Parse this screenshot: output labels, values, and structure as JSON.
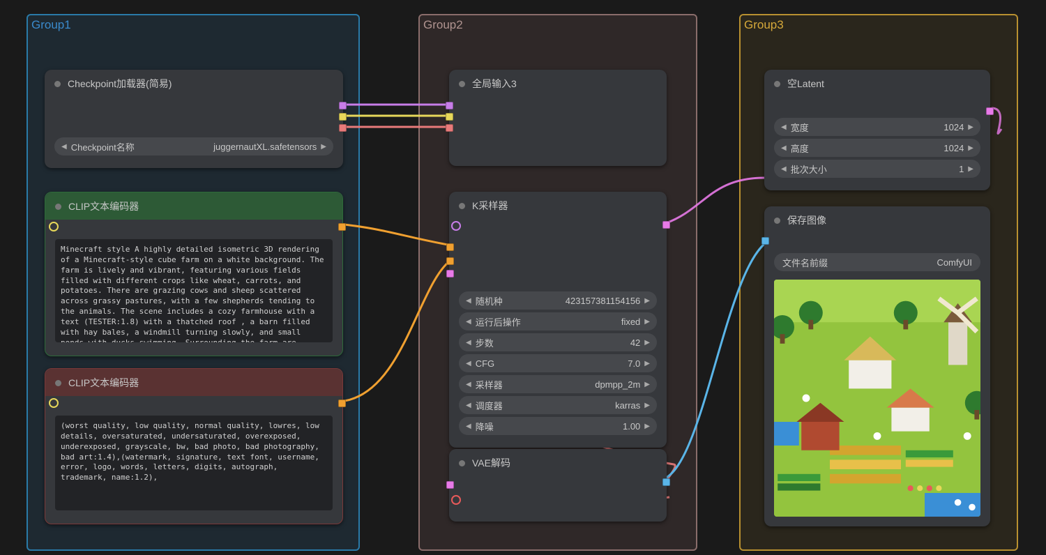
{
  "groups": {
    "g1": "Group1",
    "g2": "Group2",
    "g3": "Group3"
  },
  "checkpoint": {
    "title": "Checkpoint加载器(简易)",
    "param_label": "Checkpoint名称",
    "param_value": "juggernautXL.safetensors"
  },
  "clip_pos": {
    "title": "CLIP文本编码器",
    "text": "Minecraft style A highly detailed isometric 3D rendering of a Minecraft-style cube farm on a white background. The farm is lively and vibrant, featuring various fields filled with different crops like wheat, carrots, and potatoes. There are grazing cows and sheep scattered across grassy pastures, with a few shepherds tending to the animals. The scene includes a cozy farmhouse with a text (TESTER:1.8) with a thatched roof , a barn filled with hay bales, a windmill turning slowly, and small ponds with ducks swimming. Surrounding the farm are colorful gardens full of flowers, fruit trees, and vegetable patches. The entire scene is"
  },
  "clip_neg": {
    "title": "CLIP文本编码器",
    "text": "(worst quality, low quality, normal quality, lowres, low details, oversaturated, undersaturated, overexposed, underexposed, grayscale, bw, bad photo, bad photography, bad art:1.4),(watermark, signature, text font, username, error, logo, words, letters, digits, autograph, trademark, name:1.2),"
  },
  "reroute": {
    "title": "全局输入3"
  },
  "ksampler": {
    "title": "K采样器",
    "params": [
      {
        "label": "随机种",
        "value": "423157381154156"
      },
      {
        "label": "运行后操作",
        "value": "fixed"
      },
      {
        "label": "步数",
        "value": "42"
      },
      {
        "label": "CFG",
        "value": "7.0"
      },
      {
        "label": "采样器",
        "value": "dpmpp_2m"
      },
      {
        "label": "调度器",
        "value": "karras"
      },
      {
        "label": "降噪",
        "value": "1.00"
      }
    ]
  },
  "vae": {
    "title": "VAE解码"
  },
  "latent": {
    "title": "空Latent",
    "params": [
      {
        "label": "宽度",
        "value": "1024"
      },
      {
        "label": "高度",
        "value": "1024"
      },
      {
        "label": "批次大小",
        "value": "1"
      }
    ]
  },
  "save": {
    "title": "保存图像",
    "prefix_label": "文件名前缀",
    "prefix_value": "ComfyUI"
  }
}
